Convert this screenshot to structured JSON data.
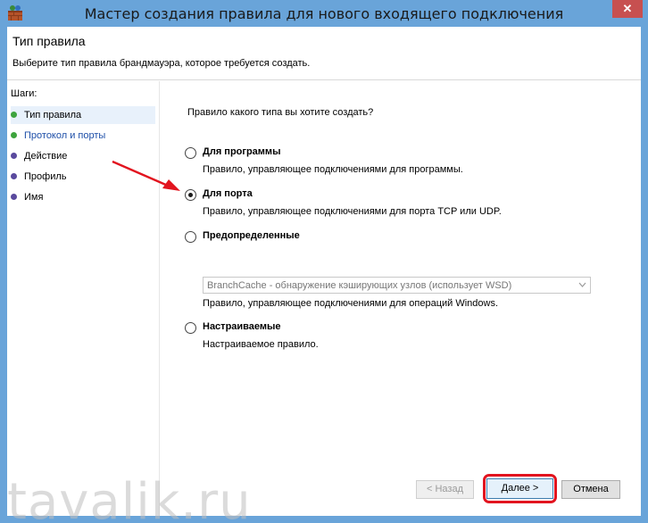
{
  "window": {
    "title": "Мастер создания правила для нового входящего подключения",
    "close_glyph": "✕"
  },
  "header": {
    "title": "Тип правила",
    "description": "Выберите тип правила брандмауэра, которое требуется создать."
  },
  "steps": {
    "title": "Шаги:",
    "items": [
      {
        "label": "Тип правила",
        "status": "done"
      },
      {
        "label": "Протокол и порты",
        "status": "done"
      },
      {
        "label": "Действие",
        "status": "pending"
      },
      {
        "label": "Профиль",
        "status": "pending"
      },
      {
        "label": "Имя",
        "status": "pending"
      }
    ]
  },
  "main": {
    "question": "Правило какого типа вы хотите создать?",
    "options": [
      {
        "label": "Для программы",
        "description": "Правило, управляющее подключениями для программы.",
        "selected": false
      },
      {
        "label": "Для порта",
        "description": "Правило, управляющее подключениями для порта TCP или UDP.",
        "selected": true
      },
      {
        "label": "Предопределенные",
        "description": "Правило, управляющее подключениями для операций Windows.",
        "selected": false
      },
      {
        "label": "Настраиваемые",
        "description": "Настраиваемое правило.",
        "selected": false
      }
    ],
    "predefined_select": {
      "value": "BranchCache - обнаружение кэширующих узлов (использует WSD)",
      "enabled": false
    }
  },
  "buttons": {
    "back": "< Назад",
    "next": "Далее >",
    "cancel": "Отмена"
  },
  "watermark": "tavalik.ru",
  "colors": {
    "titlebar": "#69a4d9",
    "step_done": "#3ea43e",
    "step_pending": "#5a4a9e",
    "annotation": "#e2141f"
  }
}
